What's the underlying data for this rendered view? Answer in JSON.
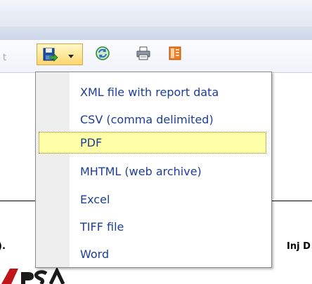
{
  "toolbar": {
    "truncated_text": "t",
    "save_icon": "save-icon",
    "refresh_icon": "refresh-icon",
    "print_icon": "printer-icon",
    "layout_icon": "page-layout-icon"
  },
  "export_menu": {
    "items": [
      {
        "label": "XML file with report data"
      },
      {
        "label": "CSV (comma delimited)"
      },
      {
        "label": "PDF",
        "selected": true
      },
      {
        "label": "MHTML (web archive)"
      },
      {
        "label": "Excel"
      },
      {
        "label": "TIFF file"
      },
      {
        "label": "Word"
      }
    ]
  },
  "report": {
    "left_fragment": ").",
    "right_fragment": "Inj D"
  },
  "colors": {
    "menu_text": "#1c3f95",
    "highlight": "#ffffa8",
    "logo_red": "#c0141b"
  }
}
